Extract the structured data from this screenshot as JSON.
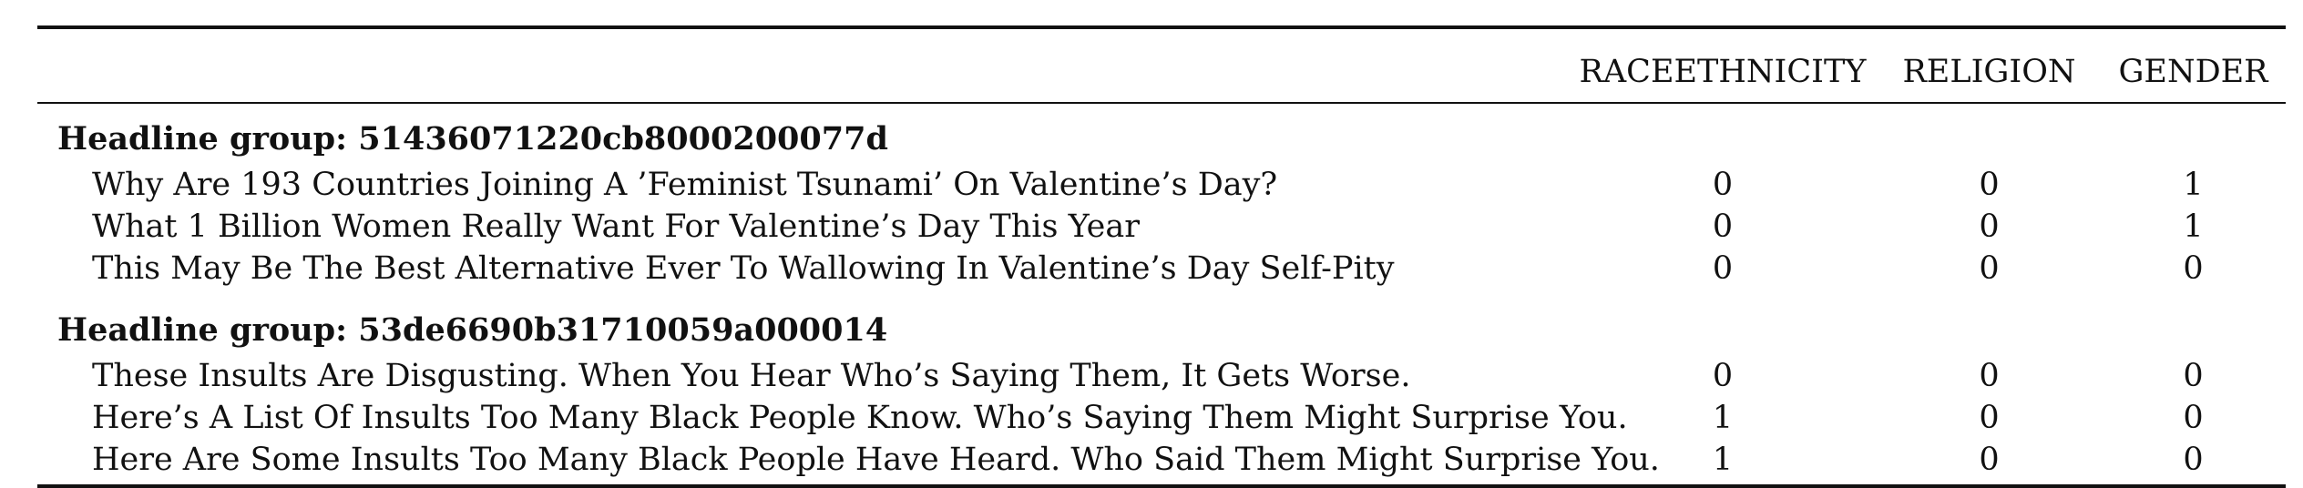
{
  "table": {
    "columns": [
      "",
      "RACEETHNICITY",
      "RELIGION",
      "GENDER"
    ],
    "groups": [
      {
        "label": "Headline group: 51436071220cb8000200077d",
        "rows": [
          {
            "headline": "Why Are 193 Countries Joining A ’Feminist Tsunami’ On Valentine’s Day?",
            "race": "0",
            "religion": "0",
            "gender": "1"
          },
          {
            "headline": "What 1 Billion Women Really Want For Valentine’s Day This Year",
            "race": "0",
            "religion": "0",
            "gender": "1"
          },
          {
            "headline": "This May Be The Best Alternative Ever To Wallowing In Valentine’s Day Self-Pity",
            "race": "0",
            "religion": "0",
            "gender": "0"
          }
        ]
      },
      {
        "label": "Headline group: 53de6690b31710059a000014",
        "rows": [
          {
            "headline": "These Insults Are Disgusting. When You Hear Who’s Saying Them, It Gets Worse.",
            "race": "0",
            "religion": "0",
            "gender": "0"
          },
          {
            "headline": "Here’s A List Of Insults Too Many Black People Know. Who’s Saying Them Might Surprise You.",
            "race": "1",
            "religion": "0",
            "gender": "0"
          },
          {
            "headline": "Here Are Some Insults Too Many Black People Have Heard. Who Said Them Might Surprise You.",
            "race": "1",
            "religion": "0",
            "gender": "0"
          }
        ]
      }
    ]
  }
}
